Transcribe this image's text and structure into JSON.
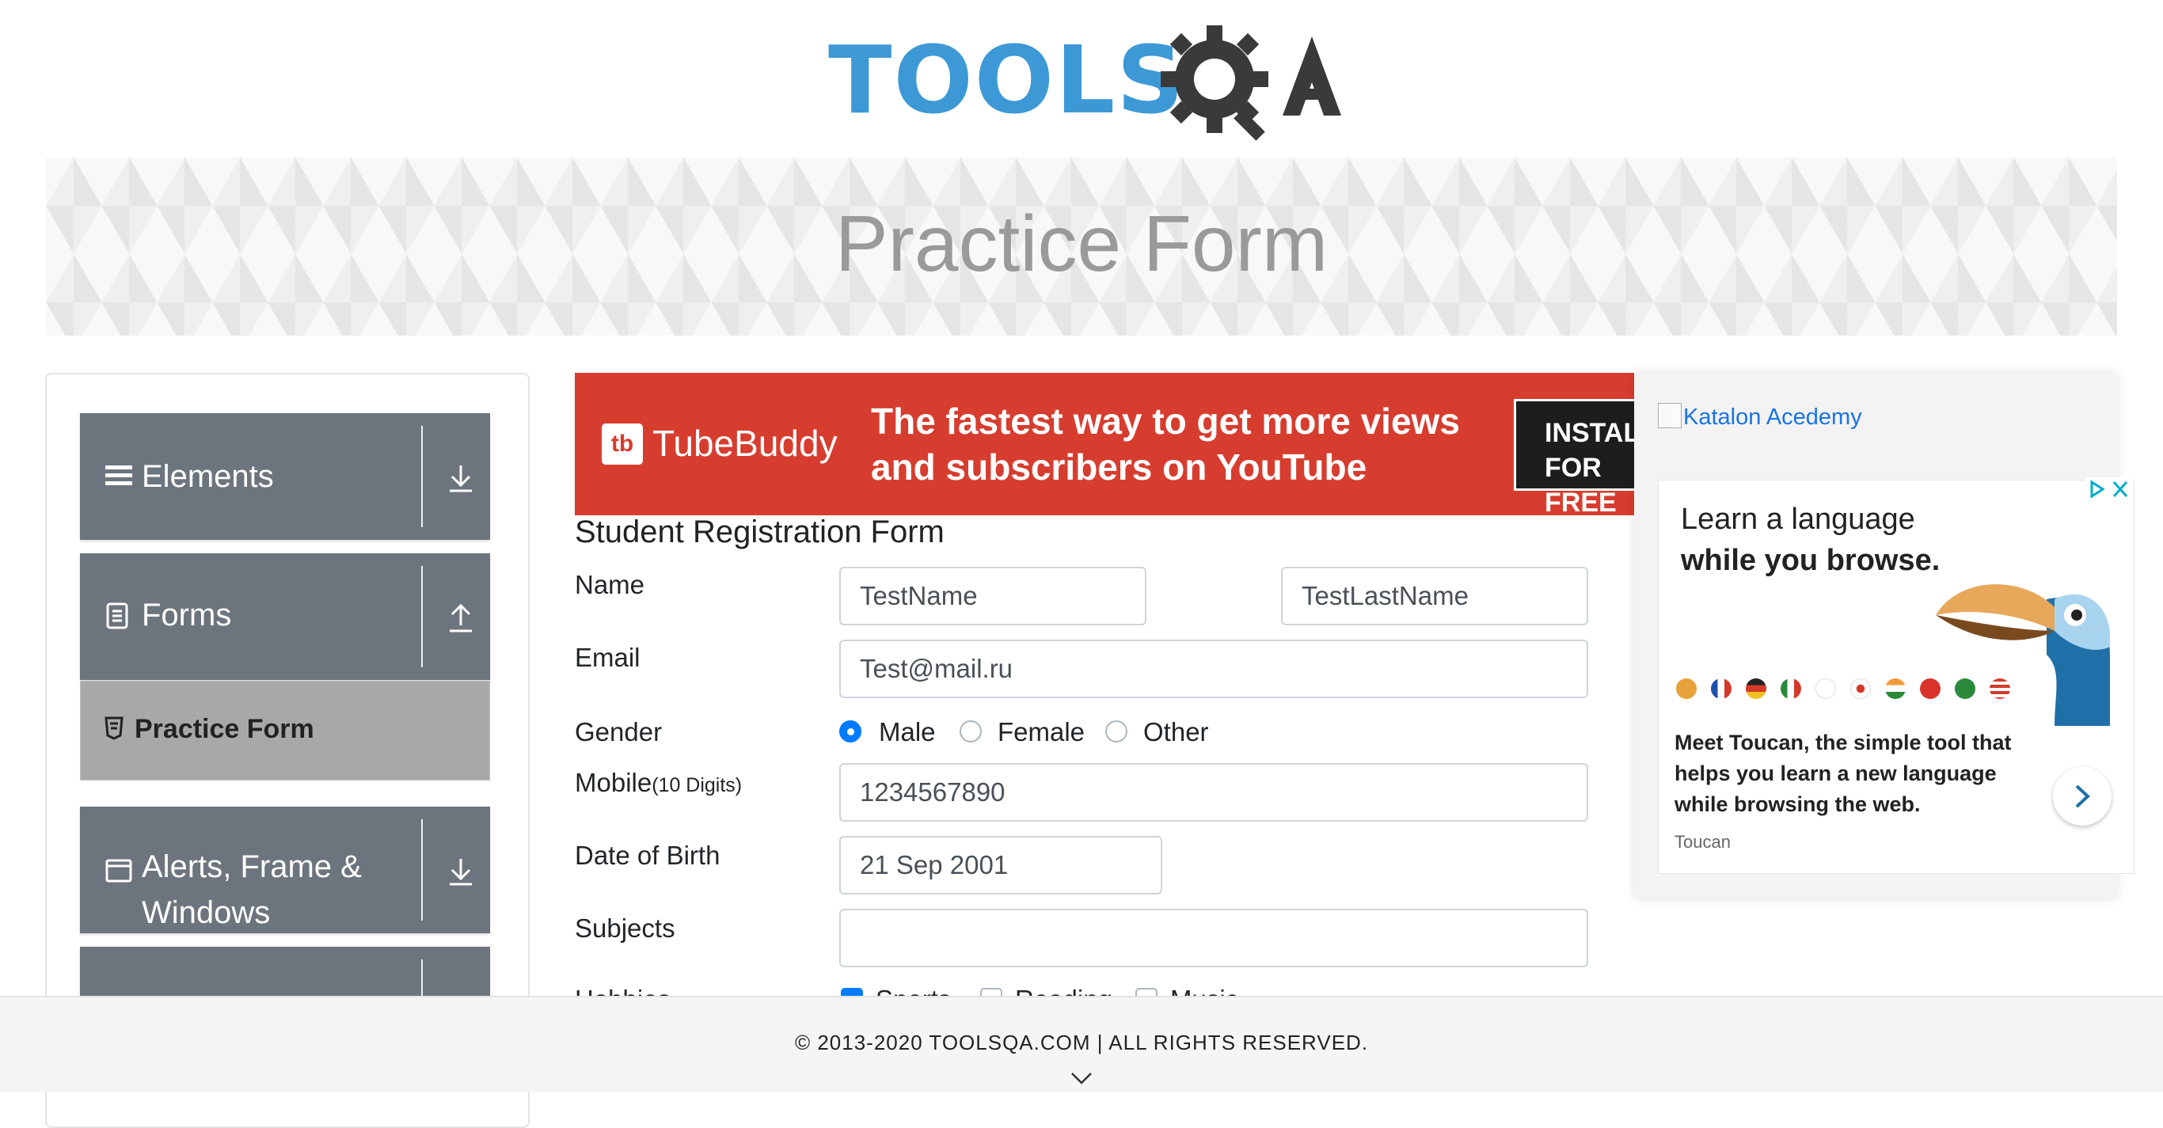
{
  "logo": {
    "part1": "TOOLS",
    "part2": "QA"
  },
  "banner": {
    "title": "Practice Form"
  },
  "sidebar": {
    "groups": [
      {
        "label": "Elements",
        "icon": "menu-icon"
      },
      {
        "label": "Forms",
        "icon": "document-icon"
      },
      {
        "label": "Alerts, Frame &",
        "label2": "Windows",
        "icon": "window-icon"
      }
    ],
    "active_item": {
      "label": "Practice Form",
      "icon": "html5-icon"
    }
  },
  "ad_banner": {
    "brand": "TubeBuddy",
    "logo_text": "tb",
    "line1": "The fastest way to get more views",
    "line2": "and subscribers on YouTube",
    "cta_line1": "INSTALL",
    "cta_line2": "FOR FREE"
  },
  "form": {
    "title": "Student Registration Form",
    "name": {
      "label": "Name",
      "first_name_value": "TestName",
      "last_name_value": "TestLastName"
    },
    "email": {
      "label": "Email",
      "value": "Test@mail.ru"
    },
    "gender": {
      "label": "Gender",
      "options": [
        "Male",
        "Female",
        "Other"
      ],
      "selected": "Male"
    },
    "mobile": {
      "label": "Mobile",
      "hint": "(10 Digits)",
      "value": "1234567890"
    },
    "dob": {
      "label": "Date of Birth",
      "value": "21 Sep 2001"
    },
    "subjects": {
      "label": "Subjects",
      "value": ""
    },
    "hobbies": {
      "label": "Hobbies",
      "options": [
        "Sports",
        "Reading",
        "Music"
      ],
      "checked": [
        "Sports"
      ]
    }
  },
  "right_ad": {
    "katalon_link": "Katalon Acedemy",
    "toucan": {
      "headline1": "Learn a language",
      "headline2": "while you browse.",
      "description": "Meet Toucan, the simple tool that helps you learn a new language while browsing the web.",
      "brand": "Toucan"
    }
  },
  "footer": {
    "text": "© 2013-2020 TOOLSQA.COM | ALL RIGHTS RESERVED."
  },
  "colors": {
    "logo_blue": "#3d99d6",
    "logo_dark": "#3a3a3a",
    "sidebar_group": "#6c757d",
    "active_item": "#a8a8a8",
    "primary": "#007bff",
    "ad_red": "#d63d2f"
  }
}
